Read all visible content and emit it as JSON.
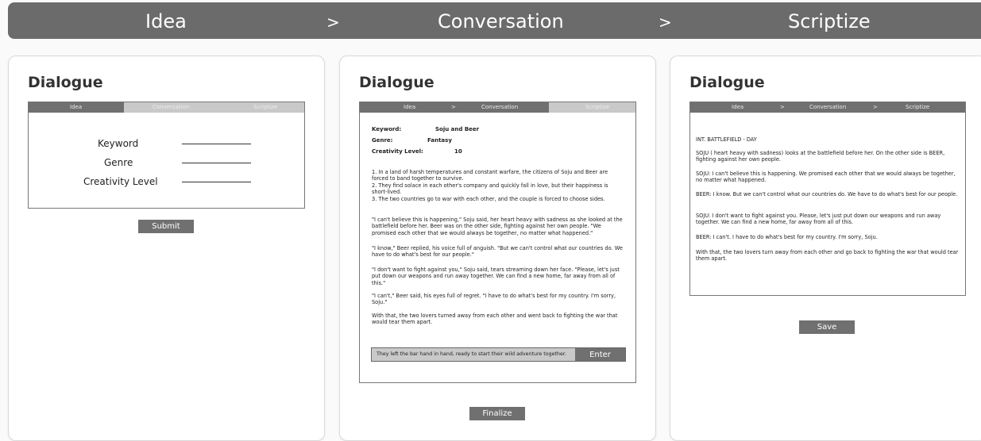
{
  "topbar": {
    "step1": "Idea",
    "sep1": ">",
    "step2": "Conversation",
    "sep2": ">",
    "step3": "Scriptize"
  },
  "card1": {
    "title": "Dialogue",
    "tabs": {
      "idea": "Idea",
      "conversation": "Conversation",
      "scriptize": "Scriptize"
    },
    "fields": {
      "keyword": "Keyword",
      "genre": "Genre",
      "creativity": "Creativity Level"
    },
    "submit": "Submit"
  },
  "card2": {
    "title": "Dialogue",
    "tabs": {
      "idea": "Idea",
      "sep1": ">",
      "conversation": "Conversation",
      "scriptize": "Scriptize"
    },
    "meta": {
      "keyword_label": "Keyword:",
      "keyword_value": "Soju and Beer",
      "genre_label": "Genre:",
      "genre_value": "Fantasy",
      "creativity_label": "Creativity Level:",
      "creativity_value": "10"
    },
    "outline": "1. In a land of harsh temperatures and constant warfare, the citizens of Soju and Beer are forced to band together to survive.\n2. They find solace in each other's company and quickly fall in love, but their happiness is short-lived.\n3. The two countries go to war with each other, and the couple is forced to choose sides.",
    "paragraphs": [
      "\"I can't believe this is happening,\" Soju said, her heart heavy with sadness as she looked at the battlefield before her. Beer was on the other side, fighting against her own people. \"We promised each other that we would always be together, no matter what happened.\"",
      "\"I know,\" Beer replied, his voice full of anguish. \"But we can't control what our countries do. We have to do what's best for our people.\"",
      "\"I don't want to fight against you,\" Soju said, tears streaming down her face. \"Please, let's just put down our weapons and run away together. We can find a new home, far away from all of this.\"",
      "\"I can't,\" Beer said, his eyes full of regret. \"I have to do what's best for my country. I'm sorry, Soju.\"",
      "With that, the two lovers turned away from each other and went back to fighting the war that would tear them apart."
    ],
    "input_value": "They left the bar hand in hand, ready to start their wild adventure together.",
    "enter": "Enter",
    "finalize": "Finalize"
  },
  "card3": {
    "title": "Dialogue",
    "tabs": {
      "idea": "Idea",
      "sep1": ">",
      "conversation": "Conversation",
      "sep2": ">",
      "scriptize": "Scriptize"
    },
    "script": [
      "INT. BATTLEFIELD - DAY",
      "SOJU ( heart heavy with sadness) looks at the battlefield before her. On the other side is BEER, fighting against her own people.",
      "SOJU: I can't believe this is happening. We promised each other that we would always be together, no matter what happened.",
      "BEER: I know. But we can't control what our countries do. We have to do what's best for our people.",
      "SOJU: I don't want to fight against you. Please, let's just put down our weapons and run away together. We can find a new home, far away from all of this.",
      "BEER: I can't. I have to do what's best for my country. I'm sorry, Soju.",
      "With that, the two lovers turn away from each other and go back to fighting the war that would tear them apart."
    ],
    "save": "Save"
  }
}
